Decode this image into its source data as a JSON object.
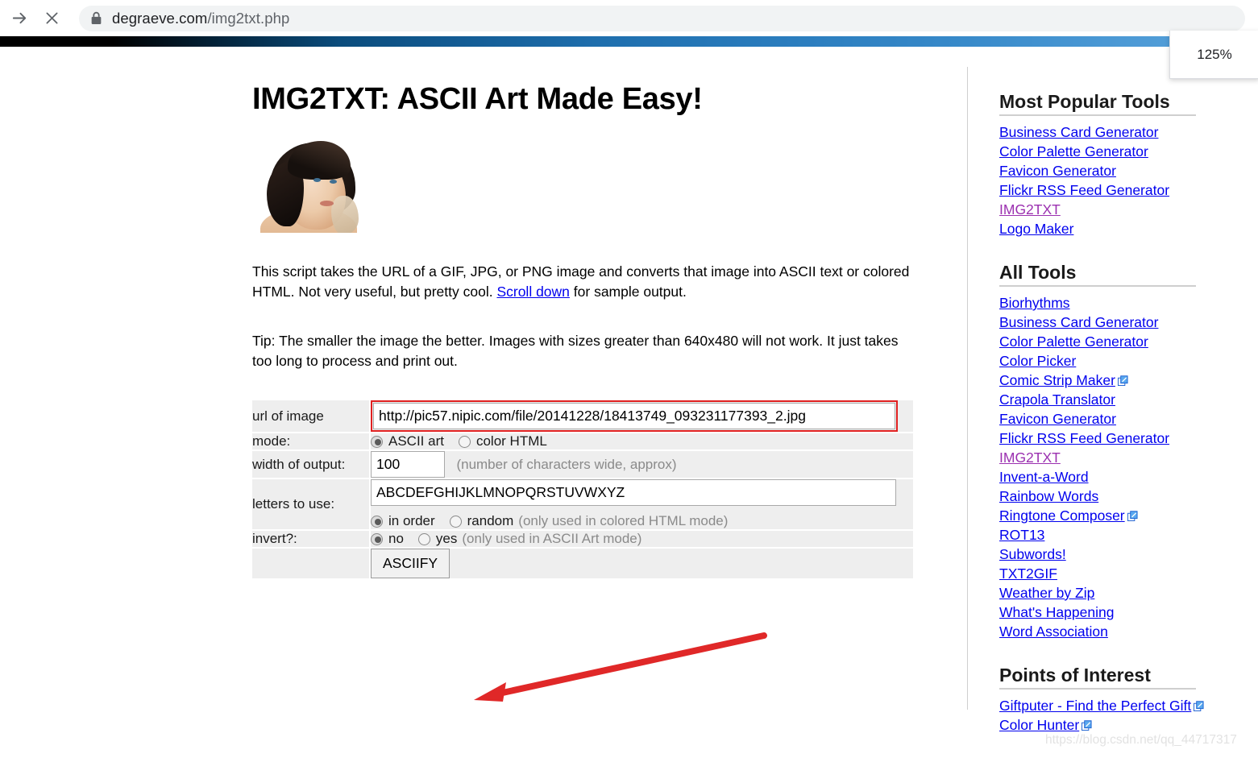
{
  "browser": {
    "forward_icon": "arrow-right-icon",
    "stop_icon": "close-x-icon",
    "lock_icon": "lock-icon",
    "url_scheme_host": "degraeve.com",
    "url_path": "/img2txt.php",
    "url_full": "degraeve.com/img2txt.php",
    "zoom_level": "125%"
  },
  "main": {
    "title": "IMG2TXT: ASCII Art Made Easy!",
    "hero_image_alt": "portrait-photo",
    "paragraph1_a": "This script takes the URL of a GIF, JPG, or PNG image and converts that image into ASCII text or colored HTML. Not very useful, but pretty cool. ",
    "paragraph1_link": "Scroll down",
    "paragraph1_b": " for sample output.",
    "paragraph2": "Tip: The smaller the image the better. Images with sizes greater than 640x480 will not work. It just takes too long to process and print out."
  },
  "form": {
    "url_label": "url of image",
    "url_value": "http://pic57.nipic.com/file/20141228/18413749_093231177393_2.jpg",
    "url_highlight_color": "#e02020",
    "mode_label": "mode:",
    "mode_options": [
      {
        "label": "ASCII art",
        "checked": true
      },
      {
        "label": "color HTML",
        "checked": false
      }
    ],
    "width_label": "width of output:",
    "width_value": "100",
    "width_hint": "(number of characters wide, approx)",
    "letters_label": "letters to use:",
    "letters_value": "ABCDEFGHIJKLMNOPQRSTUVWXYZ",
    "order_options": [
      {
        "label": "in order",
        "checked": true
      },
      {
        "label": "random",
        "checked": false
      }
    ],
    "order_hint": "(only used in colored HTML mode)",
    "invert_label": "invert?:",
    "invert_options": [
      {
        "label": "no",
        "checked": true
      },
      {
        "label": "yes",
        "checked": false
      }
    ],
    "invert_hint": "(only used in ASCII Art mode)",
    "submit_label": "ASCIIFY"
  },
  "annotation": {
    "arrow_color": "#e02828",
    "arrow_name": "red-arrow-pointing-to-asciify"
  },
  "sidebar": {
    "popular_heading": "Most Popular Tools",
    "popular_links": [
      {
        "label": "Business Card Generator",
        "visited": false,
        "external": false
      },
      {
        "label": "Color Palette Generator",
        "visited": false,
        "external": false
      },
      {
        "label": "Favicon Generator",
        "visited": false,
        "external": false
      },
      {
        "label": "Flickr RSS Feed Generator",
        "visited": false,
        "external": false
      },
      {
        "label": "IMG2TXT",
        "visited": true,
        "external": false
      },
      {
        "label": "Logo Maker",
        "visited": false,
        "external": false
      }
    ],
    "all_heading": "All Tools",
    "all_links": [
      {
        "label": "Biorhythms",
        "visited": false,
        "external": false
      },
      {
        "label": "Business Card Generator",
        "visited": false,
        "external": false
      },
      {
        "label": "Color Palette Generator",
        "visited": false,
        "external": false
      },
      {
        "label": "Color Picker",
        "visited": false,
        "external": false
      },
      {
        "label": "Comic Strip Maker",
        "visited": false,
        "external": true
      },
      {
        "label": "Crapola Translator",
        "visited": false,
        "external": false
      },
      {
        "label": "Favicon Generator",
        "visited": false,
        "external": false
      },
      {
        "label": "Flickr RSS Feed Generator",
        "visited": false,
        "external": false
      },
      {
        "label": "IMG2TXT",
        "visited": true,
        "external": false
      },
      {
        "label": "Invent-a-Word",
        "visited": false,
        "external": false
      },
      {
        "label": "Rainbow Words",
        "visited": false,
        "external": false
      },
      {
        "label": "Ringtone Composer",
        "visited": false,
        "external": true
      },
      {
        "label": "ROT13",
        "visited": false,
        "external": false
      },
      {
        "label": "Subwords!",
        "visited": false,
        "external": false
      },
      {
        "label": "TXT2GIF",
        "visited": false,
        "external": false
      },
      {
        "label": "Weather by Zip",
        "visited": false,
        "external": false
      },
      {
        "label": "What's Happening",
        "visited": false,
        "external": false
      },
      {
        "label": "Word Association",
        "visited": false,
        "external": false
      }
    ],
    "poi_heading": "Points of Interest",
    "poi_links": [
      {
        "label": "Giftputer - Find the Perfect Gift",
        "visited": false,
        "external": true
      },
      {
        "label": "Color Hunter",
        "visited": false,
        "external": true
      }
    ]
  },
  "watermark": {
    "text": "https://blog.csdn.net/qq_44717317"
  }
}
